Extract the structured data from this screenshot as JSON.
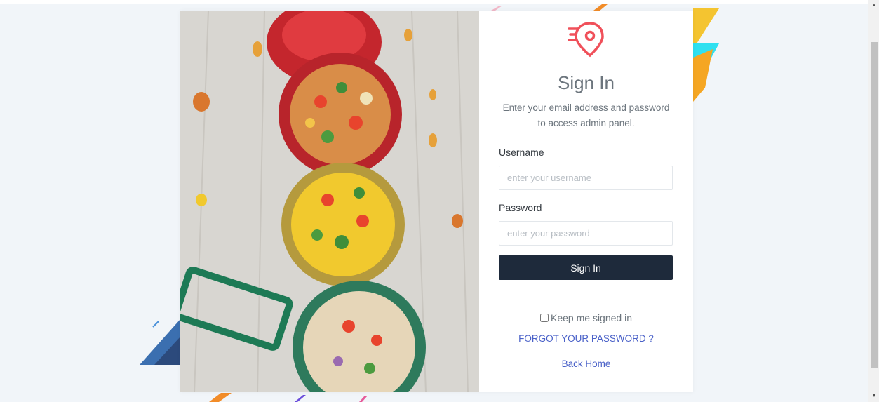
{
  "auth": {
    "title": "Sign In",
    "subtitle": "Enter your email address and password to access admin panel.",
    "username_label": "Username",
    "username_placeholder": "enter your username",
    "password_label": "Password",
    "password_placeholder": "enter your password",
    "submit_label": "Sign In",
    "remember_label": "Keep me signed in",
    "forgot_label": "FORGOT YOUR PASSWORD ?",
    "back_home_label": "Back Home"
  },
  "colors": {
    "brand": "#f0505a",
    "button": "#1e2a3b",
    "link": "#4a61c8"
  },
  "icons": {
    "logo": "fast-delivery-location-pin-icon"
  }
}
